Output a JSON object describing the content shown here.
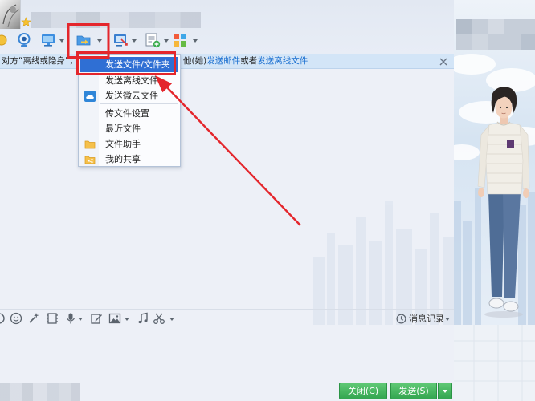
{
  "colors": {
    "accent_blue": "#2f6fd4",
    "annotation_red": "#e4262c",
    "button_green": "#37ad55",
    "link_blue": "#1a6fd0",
    "notice_bg": "#d3e5f7"
  },
  "title_bar": {
    "controls": [
      "minimize-icon",
      "maximize-icon",
      "close-icon"
    ]
  },
  "toolbar": {
    "items": [
      "video-call-icon",
      "screen-share-icon",
      "file-transfer-icon",
      "remote-desktop-icon",
      "new-document-icon",
      "apps-icon"
    ]
  },
  "notice": {
    "lead": "对方“离线或隐身”，",
    "who": "他(她)",
    "mail_link": "发送邮件",
    "or": "或者",
    "offline_link": "发送离线文件"
  },
  "file_menu": {
    "items": [
      {
        "label": "发送文件/文件夹",
        "selected": true
      },
      {
        "label": "发送离线文件"
      },
      {
        "label": "发送微云文件",
        "icon": "cloud-icon"
      },
      {
        "label": "传文件设置"
      },
      {
        "label": "最近文件"
      },
      {
        "label": "文件助手",
        "icon": "folder-icon"
      },
      {
        "label": "我的共享",
        "icon": "shared-folder-icon"
      }
    ]
  },
  "input_toolbar": {
    "items": [
      "emoji-icon",
      "magic-wand-icon",
      "film-icon",
      "microphone-icon",
      "edit-icon",
      "image-icon",
      "music-icon",
      "scissors-icon"
    ],
    "history_label": "消息记录"
  },
  "actions": {
    "close_label": "关闭(C)",
    "send_label": "发送(S)"
  }
}
